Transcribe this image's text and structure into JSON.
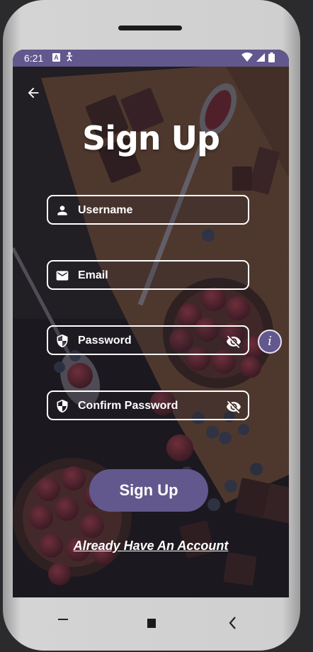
{
  "status_bar": {
    "time": "6:21",
    "notif_a": "A"
  },
  "title": "Sign Up",
  "fields": {
    "username": {
      "placeholder": "Username",
      "icon": "person-icon"
    },
    "email": {
      "placeholder": "Email",
      "icon": "mail-icon"
    },
    "password": {
      "placeholder": "Password",
      "icon": "shield-icon",
      "toggle": "eye-off-icon"
    },
    "confirm_password": {
      "placeholder": "Confirm Password",
      "icon": "shield-icon",
      "toggle": "eye-off-icon"
    }
  },
  "info_button": {
    "glyph": "i"
  },
  "signup_button": {
    "label": "Sign Up"
  },
  "login_link": {
    "label": "Already Have An Account"
  },
  "colors": {
    "accent": "#62588d",
    "field_border": "#ffffff",
    "text": "#ffffff"
  }
}
